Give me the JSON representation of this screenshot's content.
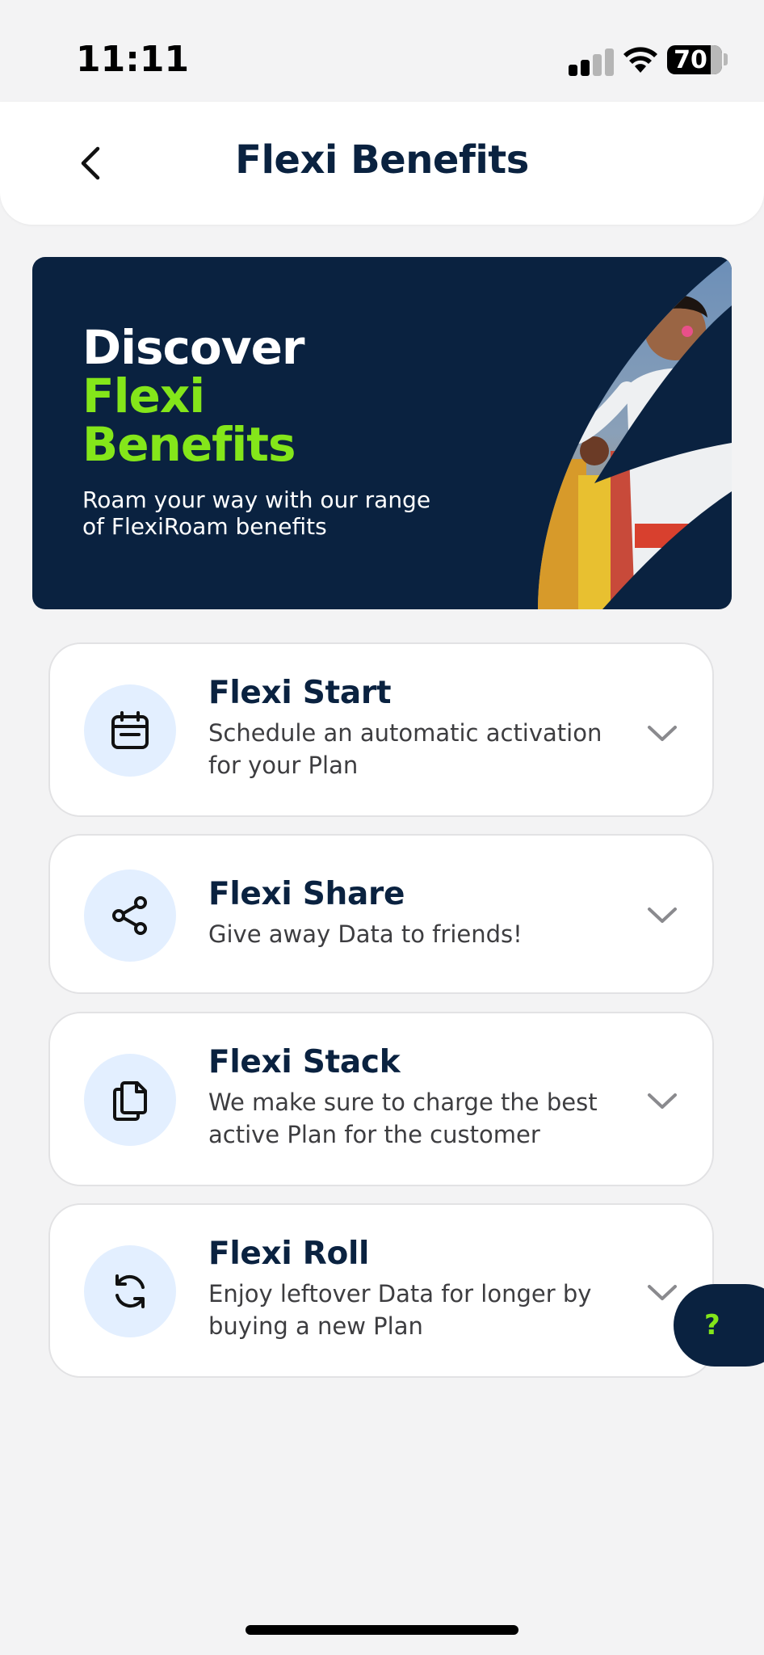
{
  "status_bar": {
    "time": "11:11",
    "battery": "70"
  },
  "header": {
    "title": "Flexi Benefits",
    "back_icon": "chevron-left-icon"
  },
  "hero": {
    "title_line1": "Discover",
    "title_line2": "Flexi",
    "title_line3": "Benefits",
    "subtitle": "Roam your way with our range of FlexiRoam benefits"
  },
  "benefits": [
    {
      "title": "Flexi Start",
      "description": "Schedule an automatic activation for your Plan",
      "icon": "calendar-icon"
    },
    {
      "title": "Flexi Share",
      "description": "Give away Data to friends!",
      "icon": "share-icon"
    },
    {
      "title": "Flexi Stack",
      "description": "We make sure to charge the best active Plan for the customer",
      "icon": "copy-documents-icon"
    },
    {
      "title": "Flexi Roll",
      "description": "Enjoy leftover Data for longer by buying a new Plan",
      "icon": "refresh-icon"
    }
  ],
  "help": {
    "label": "?"
  },
  "colors": {
    "navy": "#0a2240",
    "accent_green": "#84e61a",
    "icon_bg": "#e3efff",
    "page_bg": "#f3f3f4"
  }
}
